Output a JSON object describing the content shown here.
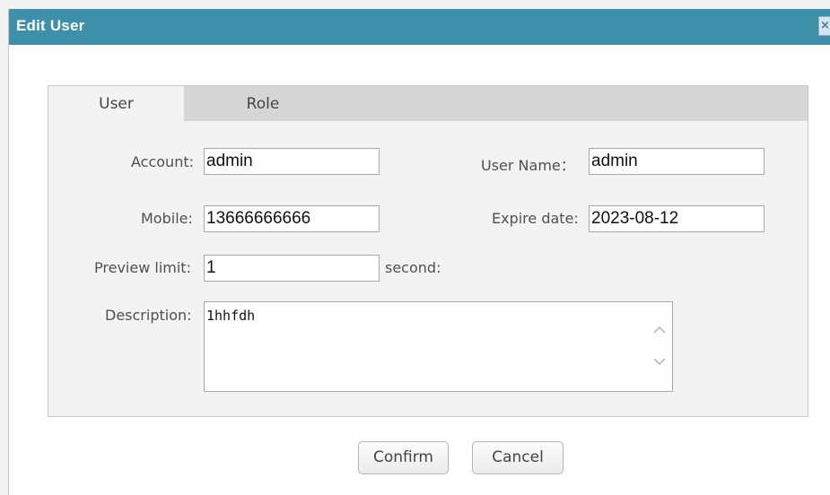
{
  "dialog": {
    "title": "Edit User",
    "close_icon": "close-icon",
    "close_label": "×"
  },
  "tabs": [
    {
      "label": "User",
      "active": true
    },
    {
      "label": "Role",
      "active": false
    }
  ],
  "form": {
    "account": {
      "label": "Account:",
      "value": "admin"
    },
    "user_name": {
      "label": "User Name：",
      "value": "admin"
    },
    "mobile": {
      "label": "Mobile:",
      "value": "13666666666"
    },
    "expire_date": {
      "label": "Expire date:",
      "value": "2023-08-12"
    },
    "preview_limit": {
      "label": "Preview limit:",
      "value": "1",
      "unit": "second:"
    },
    "description": {
      "label": "Description:",
      "value": "1hhfdh"
    }
  },
  "buttons": {
    "confirm": "Confirm",
    "cancel": "Cancel"
  },
  "colors": {
    "titlebar": "#3e8fa9",
    "tab_active": "#f3f3f3",
    "tab_bar": "#d6d6d6"
  }
}
